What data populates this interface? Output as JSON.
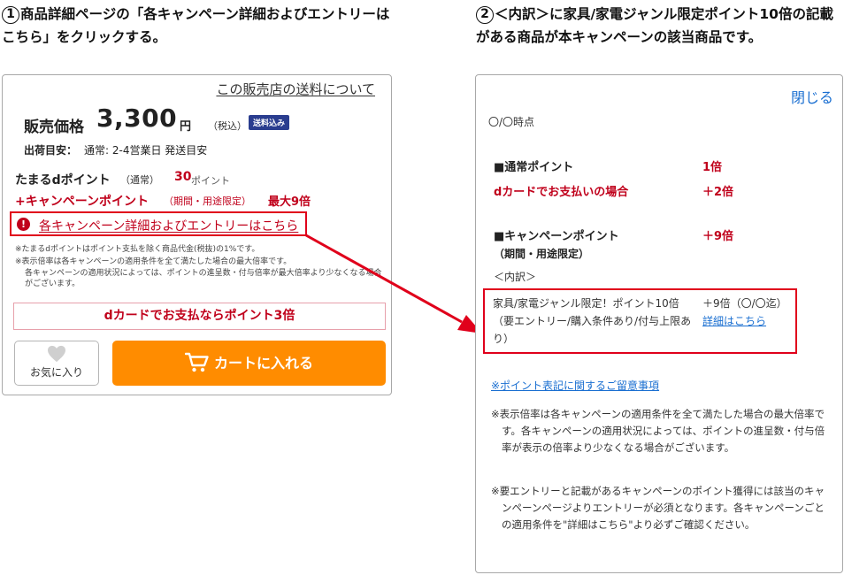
{
  "step1": {
    "num": "1",
    "text": "商品詳細ページの「各キャンペーン詳細およびエントリーはこちら」をクリックする。"
  },
  "step2": {
    "num": "2",
    "text": "＜内訳＞に家具/家電ジャンル限定ポイント10倍の記載がある商品が本キャンペーンの該当商品です。"
  },
  "product": {
    "shipping_link": "この販売店の送料について",
    "price_label": "販売価格",
    "price": "3,300",
    "yen": "円",
    "tax": "（税込）",
    "badge": "送料込み",
    "ship_est_label": "出荷目安：",
    "ship_est_value": "通常: 2-4営業日 発送目安",
    "dpoint_label": "たまるdポイント",
    "dpoint_sub": "（通常）",
    "dpoint_value": "30",
    "dpoint_unit": "ポイント",
    "campaign_label": "+キャンペーンポイント",
    "campaign_sub": "（期間・用途限定）",
    "campaign_max": "最大9倍",
    "entry_icon": "info-icon",
    "entry_link": "各キャンペーン詳細およびエントリーはこちら",
    "note1": "※たまるdポイントはポイント支払を除く商品代金(税抜)の1%です。",
    "note2": "※表示倍率は各キャンペーンの適用条件を全て満たした場合の最大倍率です。",
    "note3": "各キャンペーンの適用状況によっては、ポイントの進呈数・付与倍率が最大倍率より少なくなる場合がございます。",
    "dcard": "dカードでお支払ならポイント3倍",
    "fav_label": "お気に入り",
    "cart_label": "カートに入れる",
    "accent_color": "#ff8c00",
    "highlight_color": "#e0001b"
  },
  "popup": {
    "close": "閉じる",
    "as_of": "〇/〇時点",
    "normal_label": "■通常ポイント",
    "normal_value": "1倍",
    "dcard_label": "dカードでお支払いの場合",
    "dcard_value": "＋2倍",
    "campaign_label": "■キャンペーンポイント",
    "campaign_sub": "（期間・用途限定）",
    "campaign_value": "＋9倍",
    "breakdown": "＜内訳＞",
    "limited_text": "家具/家電ジャンル限定！ポイント10倍（要エントリー/購入条件あり/付与上限あり）",
    "limited_value": "＋9倍（〇/〇迄）",
    "detail_link": "詳細はこちら",
    "notice_link": "※ポイント表記に関するご留意事項",
    "note1": "※表示倍率は各キャンペーンの適用条件を全て満たした場合の最大倍率です。各キャンペーンの適用状況によっては、ポイントの進呈数・付与倍率が表示の倍率より少なくなる場合がございます。",
    "note2": "※要エントリーと記載があるキャンペーンのポイント獲得には該当のキャンペーンページよりエントリーが必須となります。各キャンペーンごとの適用条件を\"詳細はこちら\"より必ずご確認ください。"
  }
}
